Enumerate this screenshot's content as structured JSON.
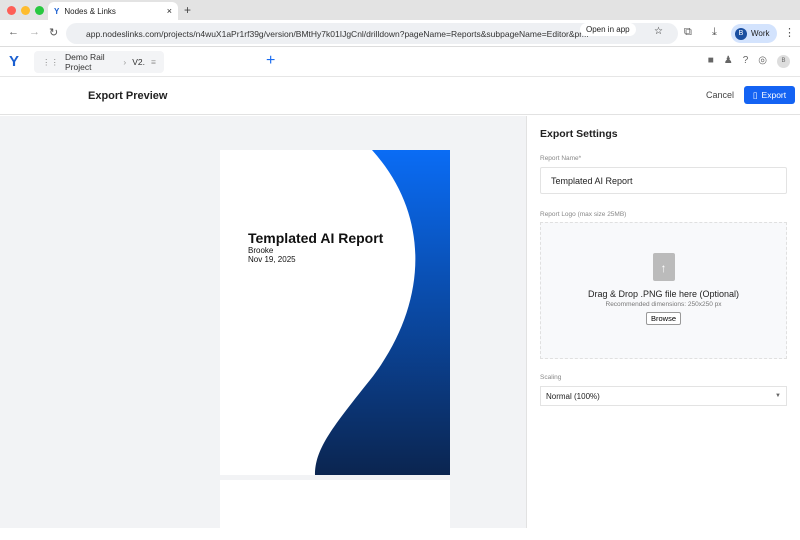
{
  "browser": {
    "tab_title": "Nodes & Links",
    "url": "app.nodeslinks.com/projects/n4wuX1aPr1rf39g/version/BMtHy7k01IJgCnl/drilldown?pageName=Reports&subpageName=Editor&pr...",
    "open_in_app": "Open in app",
    "profile_initial": "B",
    "profile_label": "Work"
  },
  "app": {
    "project": "Demo Rail Project",
    "version": "V2.",
    "avatar": "B"
  },
  "toolbar": {
    "title": "Export Preview",
    "cancel": "Cancel",
    "export": "Export"
  },
  "preview": {
    "title": "Templated AI Report",
    "author": "Brooke",
    "date": "Nov 19, 2025",
    "colors": {
      "top": "#0a6cf5",
      "bottom": "#0b2550"
    }
  },
  "settings": {
    "heading": "Export Settings",
    "report_name_label": "Report Name*",
    "report_name": "Templated AI Report",
    "logo_label": "Report Logo (max size 25MB)",
    "drop_text": "Drag & Drop .PNG file here (Optional)",
    "drop_hint": "Recommended dimensions: 250x250 px",
    "browse": "Browse",
    "scaling_label": "Scaling",
    "scaling_value": "Normal (100%)"
  }
}
